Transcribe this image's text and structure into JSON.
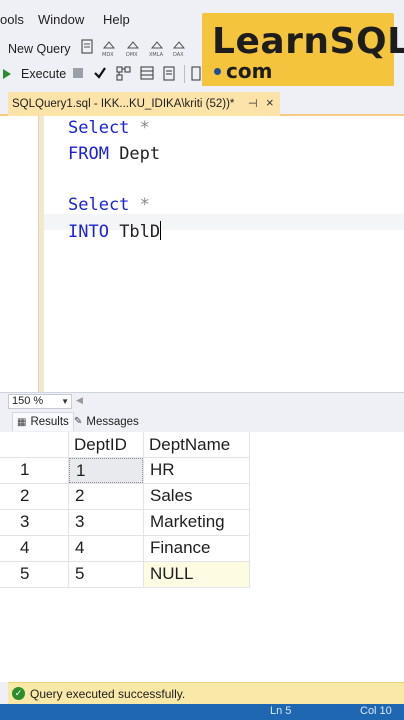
{
  "menu": {
    "items": [
      "ools",
      "Window",
      "Help"
    ]
  },
  "toolbar": {
    "new_query_label": "New Query",
    "execute_label": "Execute",
    "icon_labels": [
      "MDX",
      "DMX",
      "XMLA",
      "DAX"
    ]
  },
  "logo": {
    "main": "LearnSQL",
    "sub": "com",
    "color": "#f3c43c"
  },
  "document_tab": {
    "title": "SQLQuery1.sql - IKK...KU_IDIKA\\kriti (52))*"
  },
  "editor": {
    "lines": [
      {
        "kw": "Select",
        "rest": " *"
      },
      {
        "kw": "FROM",
        "rest": " Dept"
      },
      {
        "kw": "Select",
        "rest": " *"
      },
      {
        "kw": "INTO",
        "rest": " TblD"
      }
    ]
  },
  "zoom": {
    "value": "150 %"
  },
  "results_tabs": {
    "results_label": "Results",
    "messages_label": "Messages"
  },
  "results_grid": {
    "columns": [
      "DeptID",
      "DeptName"
    ],
    "rows": [
      {
        "num": "1",
        "id": "1",
        "name": "HR"
      },
      {
        "num": "2",
        "id": "2",
        "name": "Sales"
      },
      {
        "num": "3",
        "id": "3",
        "name": "Marketing"
      },
      {
        "num": "4",
        "id": "4",
        "name": "Finance"
      },
      {
        "num": "5",
        "id": "5",
        "name": "NULL"
      }
    ]
  },
  "status": {
    "text": "Query executed successfully.",
    "footer": [
      "Ln 5",
      "Col 10"
    ]
  }
}
